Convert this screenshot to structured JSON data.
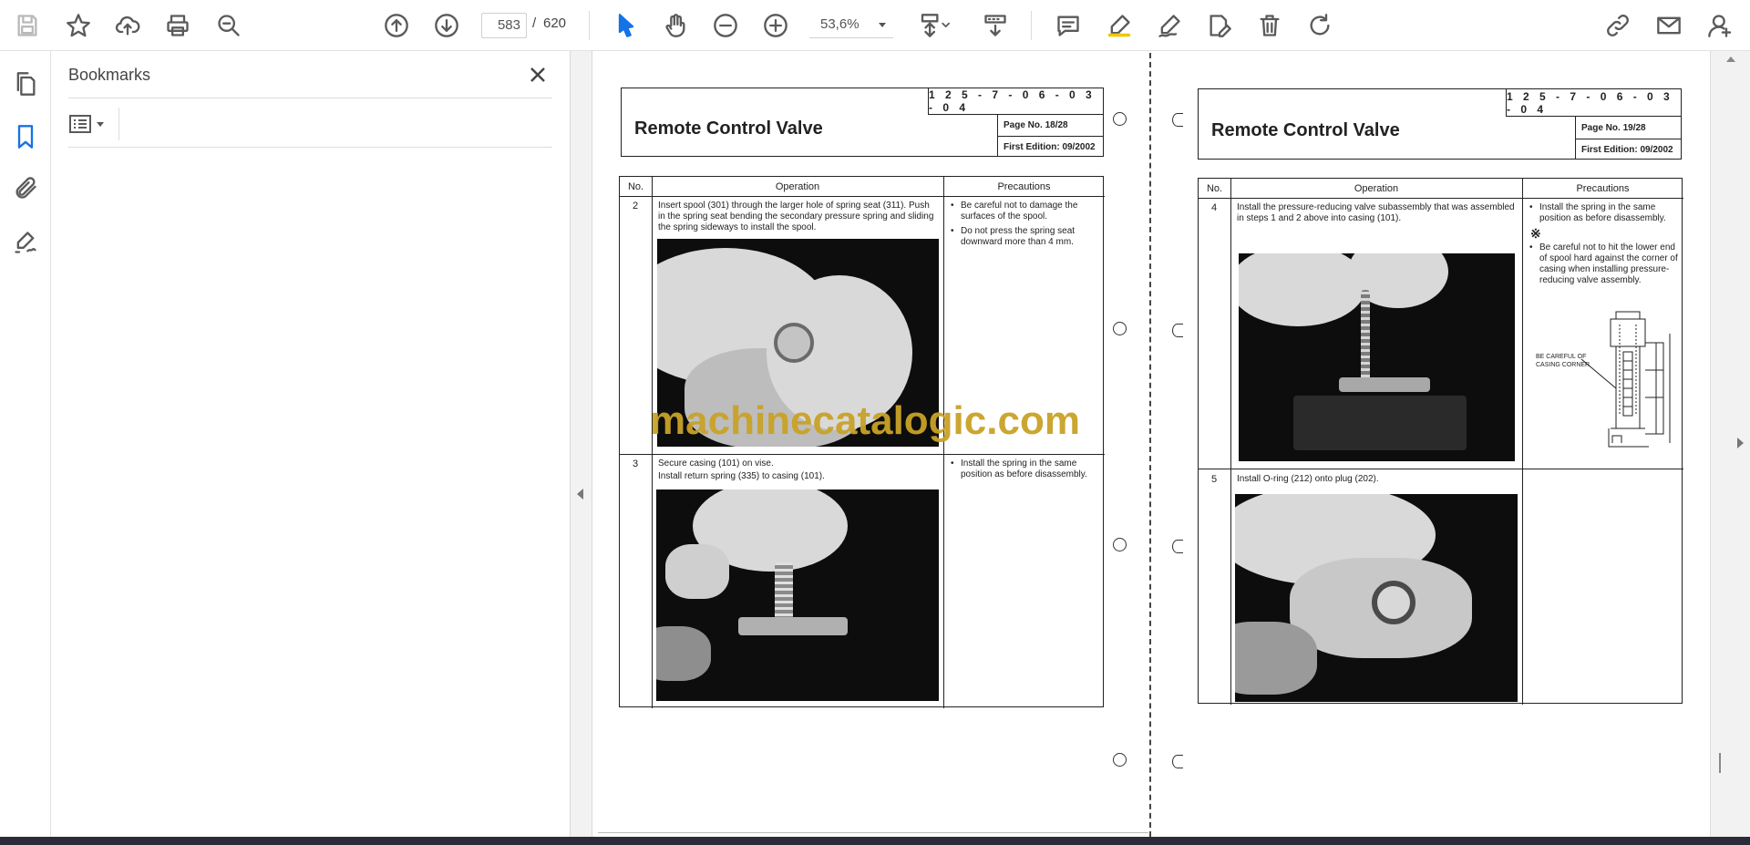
{
  "toolbar": {
    "icons": [
      "save-icon",
      "star-icon",
      "upload-icon",
      "print-icon",
      "find-icon",
      "arrow-up-circle-icon",
      "arrow-down-circle-icon",
      "select-pointer-icon",
      "hand-icon",
      "zoom-out-icon",
      "zoom-in-icon",
      "fit-page-icon",
      "scroll-mode-icon",
      "comment-icon",
      "highlight-icon",
      "draw-icon",
      "edit-text-icon",
      "delete-icon",
      "rotate-icon",
      "share-link-icon",
      "email-icon",
      "account-icon"
    ],
    "current_page": "583",
    "page_separator": "/",
    "total_pages": "620",
    "zoom": "53,6%"
  },
  "rail": {
    "icons": [
      "page-thumbnails-icon",
      "bookmark-icon",
      "attachment-icon",
      "signature-icon"
    ]
  },
  "bookmarks_panel": {
    "title": "Bookmarks"
  },
  "watermark": "machinecatalogic.com",
  "pages": [
    {
      "doc_code": "1 2 5 - 7 - 0 6 - 0 3 - 0 4",
      "title": "Remote Control Valve",
      "page_no": "Page No. 18/28",
      "edition": "First Edition: 09/2002",
      "headers": {
        "no": "No.",
        "operation": "Operation",
        "precautions": "Precautions"
      },
      "rows": [
        {
          "no": "2",
          "operation": [
            "Insert spool (301) through the larger hole of spring seat (311). Push in the spring seat bending the secondary pressure spring and sliding the spring sideways to install the spool."
          ],
          "precautions": [
            "Be careful not to damage the surfaces of the spool.",
            "Do not press the spring seat downward more than 4 mm."
          ]
        },
        {
          "no": "3",
          "operation": [
            "Secure casing (101) on vise.",
            "Install return spring (335) to casing (101)."
          ],
          "precautions": [
            "Install the spring in the same position as before disassembly."
          ]
        }
      ]
    },
    {
      "doc_code": "1 2 5 - 7 - 0 6 - 0 3 - 0 4",
      "title": "Remote Control Valve",
      "page_no": "Page No. 19/28",
      "edition": "First Edition: 09/2002",
      "headers": {
        "no": "No.",
        "operation": "Operation",
        "precautions": "Precautions"
      },
      "rows": [
        {
          "no": "4",
          "operation": [
            "Install the pressure-reducing valve subassembly that was assembled in steps 1 and 2 above into casing (101)."
          ],
          "precautions": [
            "Install the spring in the same position as before disassembly.",
            "Be careful not to hit the lower end of spool hard against the corner of casing when installing pressure-reducing valve assembly."
          ],
          "ref_mark": "※",
          "diagram_label_1": "BE CAREFUL OF",
          "diagram_label_2": "CASING CORNER"
        },
        {
          "no": "5",
          "operation": [
            "Install O-ring (212) onto plug (202)."
          ],
          "precautions": []
        }
      ]
    }
  ]
}
